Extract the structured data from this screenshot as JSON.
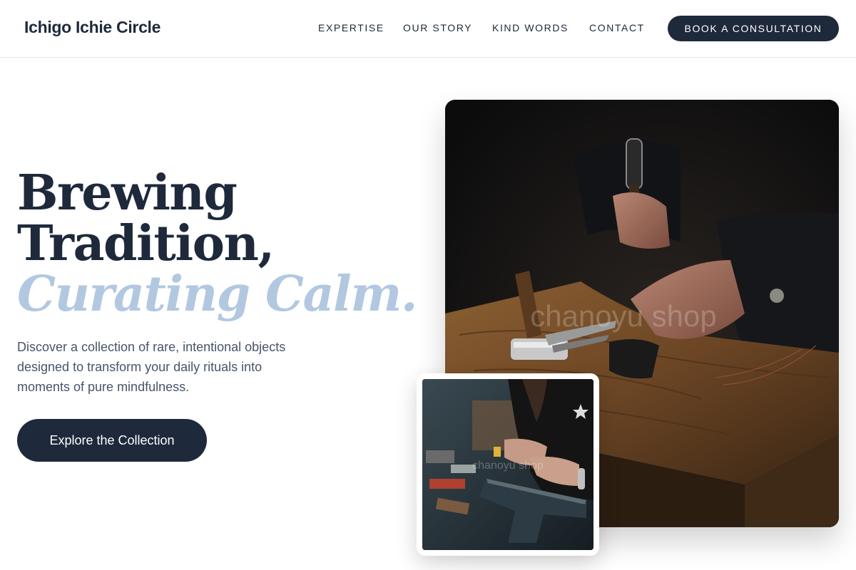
{
  "header": {
    "brand": "Ichigo Ichie Circle",
    "nav": [
      "EXPERTISE",
      "OUR STORY",
      "KIND WORDS",
      "CONTACT"
    ],
    "cta": "BOOK A CONSULTATION"
  },
  "hero": {
    "title_line1": "Brewing",
    "title_line2": "Tradition,",
    "title_accent": "Curating Calm.",
    "subtitle": "Discover a collection of rare, intentional objects designed to transform your daily rituals into moments of pure mindfulness.",
    "cta": "Explore the Collection"
  },
  "images": {
    "main_watermark": "chanoyu shop",
    "inset_watermark": "chanoyu shop"
  },
  "colors": {
    "primary": "#1e293b",
    "accent": "#b2c8e0",
    "body_text": "#475569",
    "background": "#ffffff"
  }
}
